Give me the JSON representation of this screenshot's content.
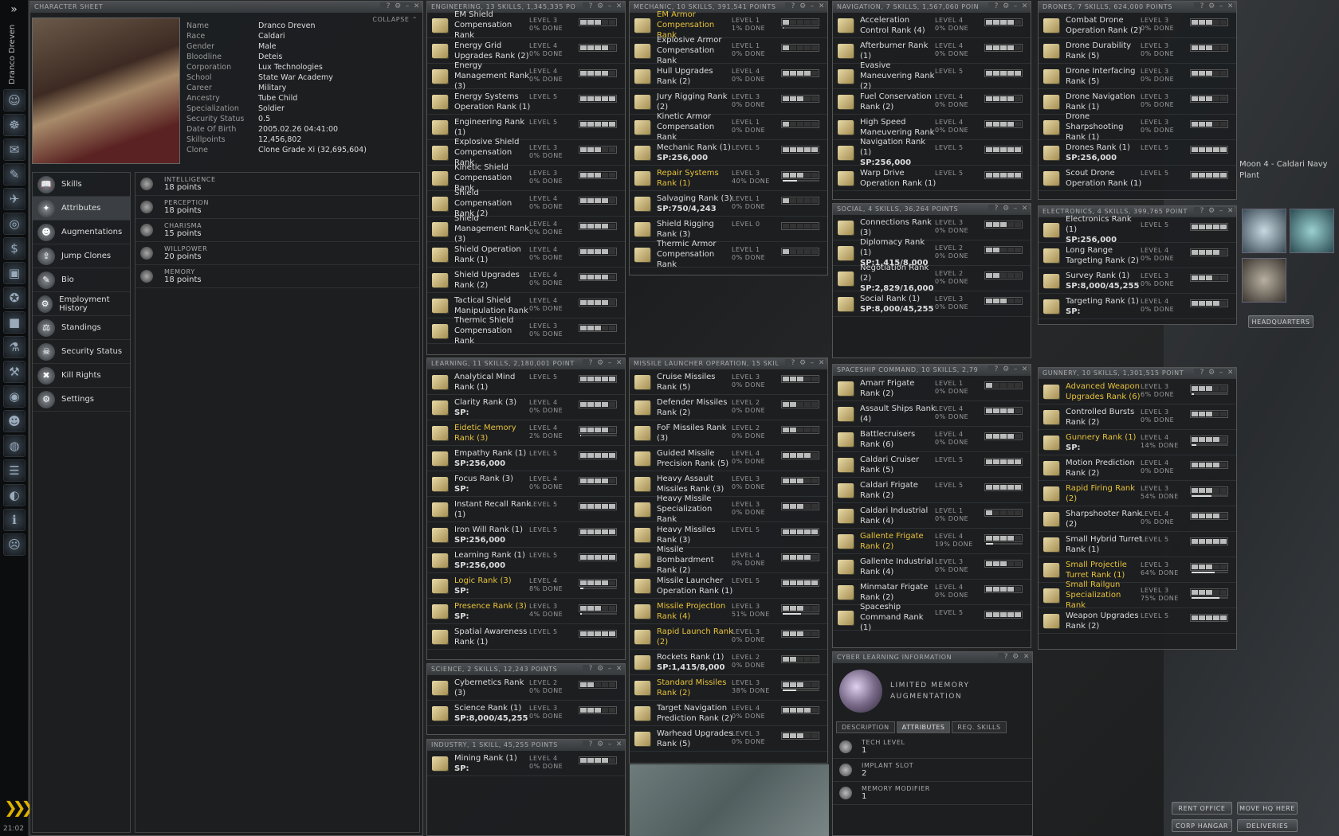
{
  "neocom": {
    "name": "Dranco Dreven",
    "clock": "21:02"
  },
  "character": {
    "title": "CHARACTER SHEET",
    "collapse": "COLLAPSE",
    "fields": [
      [
        "Name",
        "Dranco Dreven"
      ],
      [
        "Race",
        "Caldari"
      ],
      [
        "Gender",
        "Male"
      ],
      [
        "Bloodline",
        "Deteis"
      ],
      [
        "Corporation",
        "Lux Technologies"
      ],
      [
        "School",
        "State War Academy"
      ],
      [
        "Career",
        "Military"
      ],
      [
        "Ancestry",
        "Tube Child"
      ],
      [
        "Specialization",
        "Soldier"
      ],
      [
        "Security Status",
        "0.5"
      ],
      [
        "Date Of Birth",
        "2005.02.26 04:41:00"
      ],
      [
        "Skillpoints",
        "12,456,802"
      ],
      [
        "Clone",
        "Clone Grade Xi (32,695,604)"
      ]
    ],
    "menu": [
      [
        "Skills",
        "📖"
      ],
      [
        "Attributes",
        "✦"
      ],
      [
        "Augmentations",
        "☻"
      ],
      [
        "Jump Clones",
        "⇪"
      ],
      [
        "Bio",
        "✎"
      ],
      [
        "Employment History",
        "⚙"
      ],
      [
        "Standings",
        "⚖"
      ],
      [
        "Security Status",
        "☠"
      ],
      [
        "Kill Rights",
        "✖"
      ],
      [
        "Settings",
        "⚙"
      ]
    ],
    "attributes": [
      [
        "INTELLIGENCE",
        "18 points"
      ],
      [
        "PERCEPTION",
        "18 points"
      ],
      [
        "CHARISMA",
        "15 points"
      ],
      [
        "WILLPOWER",
        "20 points"
      ],
      [
        "MEMORY",
        "18 points"
      ]
    ]
  },
  "groups": {
    "engineering": {
      "title": "ENGINEERING, 13 SKILLS, 1,345,335 PO",
      "skills": [
        {
          "n": "EM Shield Compensation Rank",
          "lv": 3,
          "pct": 0
        },
        {
          "n": "Energy Grid Upgrades Rank (2)",
          "lv": 4,
          "pct": 0
        },
        {
          "n": "Energy Management Rank (3)",
          "lv": 4,
          "pct": 0
        },
        {
          "n": "Energy Systems Operation Rank (1)",
          "lv": 5
        },
        {
          "n": "Engineering Rank (1)",
          "lv": 5
        },
        {
          "n": "Explosive Shield Compensation Rank",
          "lv": 3,
          "pct": 0
        },
        {
          "n": "Kinetic Shield Compensation Rank",
          "lv": 3,
          "pct": 0
        },
        {
          "n": "Shield Compensation Rank (2)",
          "lv": 4,
          "pct": 0
        },
        {
          "n": "Shield Management Rank (3)",
          "lv": 4,
          "pct": 0
        },
        {
          "n": "Shield Operation Rank (1)",
          "lv": 4,
          "pct": 0
        },
        {
          "n": "Shield Upgrades Rank (2)",
          "lv": 4,
          "pct": 0
        },
        {
          "n": "Tactical Shield Manipulation Rank",
          "lv": 4,
          "pct": 0
        },
        {
          "n": "Thermic Shield Compensation Rank",
          "lv": 3,
          "pct": 0
        }
      ]
    },
    "mechanic": {
      "title": "MECHANIC, 10 SKILLS, 391,541 POINTS",
      "skills": [
        {
          "n": "EM Armor Compensation Rank",
          "lv": 1,
          "pct": 1,
          "hl": true
        },
        {
          "n": "Explosive Armor Compensation Rank",
          "lv": 1,
          "pct": 0
        },
        {
          "n": "Hull Upgrades Rank (2)",
          "lv": 4,
          "pct": 0
        },
        {
          "n": "Jury Rigging Rank (2)",
          "lv": 3,
          "pct": 0
        },
        {
          "n": "Kinetic Armor Compensation Rank",
          "lv": 1,
          "pct": 0
        },
        {
          "n": "Mechanic Rank (1)",
          "lv": 5,
          "sp": "256,000"
        },
        {
          "n": "Repair Systems Rank (1)",
          "lv": 3,
          "pct": 40,
          "hl": true
        },
        {
          "n": "Salvaging Rank (3)",
          "lv": 1,
          "pct": 0,
          "sp": "750/4,243"
        },
        {
          "n": "Shield Rigging Rank (3)",
          "lv": 0
        },
        {
          "n": "Thermic Armor Compensation Rank",
          "lv": 1,
          "pct": 0
        }
      ]
    },
    "navigation": {
      "title": "NAVIGATION, 7 SKILLS, 1,567,060 POIN",
      "skills": [
        {
          "n": "Acceleration Control Rank (4)",
          "lv": 4,
          "pct": 0
        },
        {
          "n": "Afterburner Rank (1)",
          "lv": 4,
          "pct": 0
        },
        {
          "n": "Evasive Maneuvering Rank (2)",
          "lv": 5
        },
        {
          "n": "Fuel Conservation Rank (2)",
          "lv": 4,
          "pct": 0
        },
        {
          "n": "High Speed Maneuvering Rank",
          "lv": 4,
          "pct": 0
        },
        {
          "n": "Navigation Rank (1)",
          "lv": 5,
          "sp": "256,000"
        },
        {
          "n": "Warp Drive Operation Rank (1)",
          "lv": 5
        }
      ]
    },
    "drones": {
      "title": "DRONES, 7 SKILLS, 624,000 POINTS",
      "skills": [
        {
          "n": "Combat Drone Operation Rank (2)",
          "lv": 3,
          "pct": 0
        },
        {
          "n": "Drone Durability Rank (5)",
          "lv": 3,
          "pct": 0
        },
        {
          "n": "Drone Interfacing Rank (5)",
          "lv": 3,
          "pct": 0
        },
        {
          "n": "Drone Navigation Rank (1)",
          "lv": 3,
          "pct": 0
        },
        {
          "n": "Drone Sharpshooting Rank (1)",
          "lv": 3,
          "pct": 0
        },
        {
          "n": "Drones Rank (1)",
          "lv": 5,
          "sp": "256,000"
        },
        {
          "n": "Scout Drone Operation Rank (1)",
          "lv": 5
        }
      ]
    },
    "social": {
      "title": "SOCIAL, 4 SKILLS, 36,264 POINTS",
      "skills": [
        {
          "n": "Connections Rank (3)",
          "lv": 3,
          "pct": 0
        },
        {
          "n": "Diplomacy Rank (1)",
          "lv": 2,
          "pct": 0,
          "sp": "1,415/8,000"
        },
        {
          "n": "Negotiation Rank (2)",
          "lv": 2,
          "pct": 0,
          "sp": "2,829/16,000"
        },
        {
          "n": "Social Rank (1)",
          "lv": 3,
          "pct": 0,
          "sp": "8,000/45,255"
        }
      ]
    },
    "electronics": {
      "title": "ELECTRONICS, 4 SKILLS, 399,765 POINT",
      "skills": [
        {
          "n": "Electronics Rank (1)",
          "lv": 5,
          "sp": "256,000"
        },
        {
          "n": "Long Range Targeting Rank (2)",
          "lv": 4,
          "pct": 0
        },
        {
          "n": "Survey Rank (1)",
          "lv": 3,
          "pct": 0,
          "sp": "8,000/45,255"
        },
        {
          "n": "Targeting Rank (1)",
          "lv": 4,
          "pct": 0,
          "sp": ""
        }
      ]
    },
    "learning": {
      "title": "LEARNING, 11 SKILLS, 2,180,001 POINT",
      "skills": [
        {
          "n": "Analytical Mind Rank (1)",
          "lv": 5
        },
        {
          "n": "Clarity Rank (3)",
          "lv": 4,
          "pct": 0,
          "sp": ""
        },
        {
          "n": "Eidetic Memory Rank (3)",
          "lv": 4,
          "pct": 2,
          "hl": true
        },
        {
          "n": "Empathy Rank (1)",
          "lv": 5,
          "sp": "256,000"
        },
        {
          "n": "Focus Rank (3)",
          "lv": 4,
          "pct": 0,
          "sp": ""
        },
        {
          "n": "Instant Recall Rank (1)",
          "lv": 5
        },
        {
          "n": "Iron Will Rank (1)",
          "lv": 5,
          "sp": "256,000"
        },
        {
          "n": "Learning Rank (1)",
          "lv": 5,
          "sp": "256,000"
        },
        {
          "n": "Logic Rank (3)",
          "lv": 4,
          "pct": 8,
          "hl": true,
          "sp": ""
        },
        {
          "n": "Presence Rank (3)",
          "lv": 3,
          "pct": 4,
          "hl": true,
          "sp": ""
        },
        {
          "n": "Spatial Awareness Rank (1)",
          "lv": 5
        }
      ]
    },
    "missile": {
      "title": "MISSILE LAUNCHER OPERATION, 15 SKIL",
      "skills": [
        {
          "n": "Cruise Missiles Rank (5)",
          "lv": 3,
          "pct": 0
        },
        {
          "n": "Defender Missiles Rank (2)",
          "lv": 2,
          "pct": 0
        },
        {
          "n": "FoF Missiles Rank (3)",
          "lv": 2,
          "pct": 0
        },
        {
          "n": "Guided Missile Precision Rank (5)",
          "lv": 4,
          "pct": 0
        },
        {
          "n": "Heavy Assault Missiles Rank (3)",
          "lv": 3,
          "pct": 0
        },
        {
          "n": "Heavy Missile Specialization Rank",
          "lv": 3,
          "pct": 0
        },
        {
          "n": "Heavy Missiles Rank (3)",
          "lv": 5
        },
        {
          "n": "Missile Bombardment Rank (2)",
          "lv": 4,
          "pct": 0
        },
        {
          "n": "Missile Launcher Operation Rank (1)",
          "lv": 5
        },
        {
          "n": "Missile Projection Rank (4)",
          "lv": 3,
          "pct": 51,
          "hl": true
        },
        {
          "n": "Rapid Launch Rank (2)",
          "lv": 3,
          "pct": 0,
          "hl": true
        },
        {
          "n": "Rockets Rank (1)",
          "lv": 2,
          "pct": 0,
          "sp": "1,415/8,000"
        },
        {
          "n": "Standard Missiles Rank (2)",
          "lv": 3,
          "pct": 38,
          "hl": true
        },
        {
          "n": "Target Navigation Prediction Rank (2)",
          "lv": 4,
          "pct": 0
        },
        {
          "n": "Warhead Upgrades Rank (5)",
          "lv": 3,
          "pct": 0
        }
      ]
    },
    "spaceship": {
      "title": "SPACESHIP COMMAND, 10 SKILLS, 2,79",
      "skills": [
        {
          "n": "Amarr Frigate Rank (2)",
          "lv": 1,
          "pct": 0
        },
        {
          "n": "Assault Ships Rank (4)",
          "lv": 4,
          "pct": 0
        },
        {
          "n": "Battlecruisers Rank (6)",
          "lv": 4,
          "pct": 0
        },
        {
          "n": "Caldari Cruiser Rank (5)",
          "lv": 5
        },
        {
          "n": "Caldari Frigate Rank (2)",
          "lv": 5
        },
        {
          "n": "Caldari Industrial Rank (4)",
          "lv": 1,
          "pct": 0
        },
        {
          "n": "Gallente Frigate Rank (2)",
          "lv": 4,
          "pct": 19,
          "hl": true
        },
        {
          "n": "Gallente Industrial Rank (4)",
          "lv": 3,
          "pct": 0
        },
        {
          "n": "Minmatar Frigate Rank (2)",
          "lv": 4,
          "pct": 0
        },
        {
          "n": "Spaceship Command Rank (1)",
          "lv": 5
        }
      ]
    },
    "gunnery": {
      "title": "GUNNERY, 10 SKILLS, 1,301,515 POINT",
      "skills": [
        {
          "n": "Advanced Weapon Upgrades Rank (6)",
          "lv": 3,
          "pct": 6,
          "hl": true
        },
        {
          "n": "Controlled Bursts Rank (2)",
          "lv": 3,
          "pct": 0
        },
        {
          "n": "Gunnery Rank (1)",
          "lv": 4,
          "pct": 14,
          "hl": true,
          "sp": ""
        },
        {
          "n": "Motion Prediction Rank (2)",
          "lv": 4,
          "pct": 0
        },
        {
          "n": "Rapid Firing Rank (2)",
          "lv": 3,
          "pct": 54,
          "hl": true
        },
        {
          "n": "Sharpshooter Rank (2)",
          "lv": 4,
          "pct": 0
        },
        {
          "n": "Small Hybrid Turret Rank (1)",
          "lv": 5
        },
        {
          "n": "Small Projectile Turret Rank (1)",
          "lv": 3,
          "pct": 64,
          "hl": true
        },
        {
          "n": "Small Railgun Specialization Rank",
          "lv": 3,
          "pct": 75,
          "hl": true
        },
        {
          "n": "Weapon Upgrades Rank (2)",
          "lv": 5
        }
      ]
    },
    "science": {
      "title": "SCIENCE, 2 SKILLS, 12,243 POINTS",
      "skills": [
        {
          "n": "Cybernetics Rank (3)",
          "lv": 2,
          "pct": 0
        },
        {
          "n": "Science Rank (1)",
          "lv": 3,
          "pct": 0,
          "sp": "8,000/45,255"
        }
      ]
    },
    "industry": {
      "title": "INDUSTRY, 1 SKILL, 45,255 POINTS",
      "skills": [
        {
          "n": "Mining Rank (1)",
          "lv": 4,
          "pct": 0,
          "sp": ""
        }
      ]
    }
  },
  "cyber": {
    "title": "CYBER LEARNING INFORMATION",
    "name": "LIMITED MEMORY AUGMENTATION",
    "tabs": [
      "DESCRIPTION",
      "ATTRIBUTES",
      "REQ. SKILLS"
    ],
    "rows": [
      [
        "TECH LEVEL",
        "1"
      ],
      [
        "IMPLANT SLOT",
        "2"
      ],
      [
        "MEMORY MODIFIER",
        "1"
      ]
    ]
  },
  "station": {
    "location": "Moon 4 - Caldari Navy Plant",
    "hq": "HEADQUARTERS",
    "buttons": [
      "RENT OFFICE",
      "MOVE HQ HERE",
      "CORP HANGAR",
      "DELIVERIES"
    ]
  },
  "labels": {
    "level": "LEVEL",
    "done": "% DONE",
    "sp": "SP:"
  }
}
